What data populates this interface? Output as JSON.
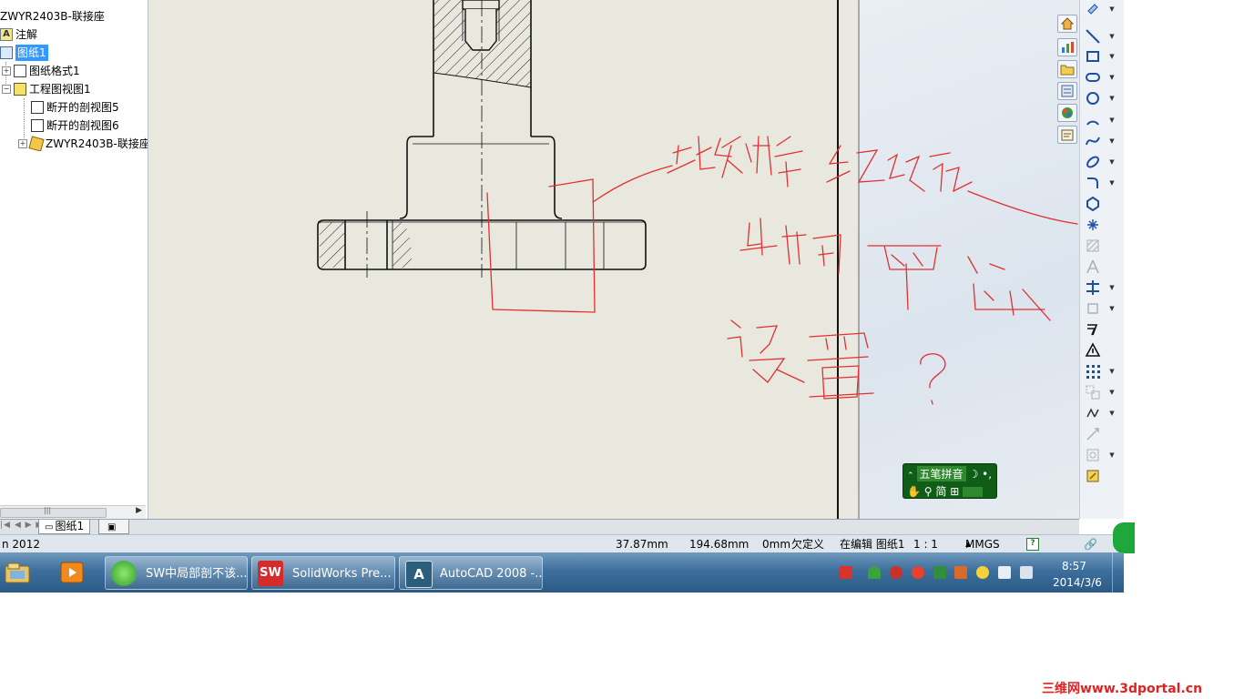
{
  "feature_tree": {
    "items": [
      {
        "label": "ZWYR2403B-联接座",
        "icon": "drawing-doc-icon"
      },
      {
        "label": "注解",
        "icon": "annotations-icon"
      },
      {
        "label": "图纸1",
        "icon": "sheet-icon",
        "selected": true
      },
      {
        "label": "图纸格式1",
        "icon": "sheet-format-icon"
      },
      {
        "label": "工程图视图1",
        "icon": "drawing-view-icon"
      },
      {
        "label": "断开的剖视图5",
        "icon": "broken-section-icon"
      },
      {
        "label": "断开的剖视图6",
        "icon": "broken-section-icon"
      },
      {
        "label": "ZWYR2403B-联接座",
        "icon": "part-icon"
      }
    ]
  },
  "sheet_tabs": {
    "active": "图纸1"
  },
  "status_bar": {
    "app_name_fragment": "n 2012",
    "x_coord": "37.87mm",
    "y_coord": "194.68mm",
    "z_coord": "0mm",
    "definition_state": "欠定义",
    "editing": "在编辑 图纸1",
    "scale": "1 : 1",
    "units": "MMGS"
  },
  "ime_bar": {
    "mode": "五笔拼音",
    "charset": "简"
  },
  "taskbar": {
    "tasks": [
      {
        "label": "SW中局部剖不该...",
        "icon": "browser-icon"
      },
      {
        "label": "SolidWorks Pre...",
        "icon": "solidworks-icon"
      },
      {
        "label": "AutoCAD 2008 -...",
        "icon": "autocad-icon"
      }
    ],
    "clock_time": "8:57",
    "clock_date": "2014/3/6"
  },
  "annotation": {
    "handwritten_text": "此处螺纹线不该出现 而怎么设置？",
    "color": "#e03030"
  },
  "watermark": "三维网www.3dportal.cn",
  "colors": {
    "canvas_background": "#e9e8df",
    "selection": "#3399ff",
    "taskbar": "#3d6f9c",
    "ime_background": "#0f5d17"
  }
}
